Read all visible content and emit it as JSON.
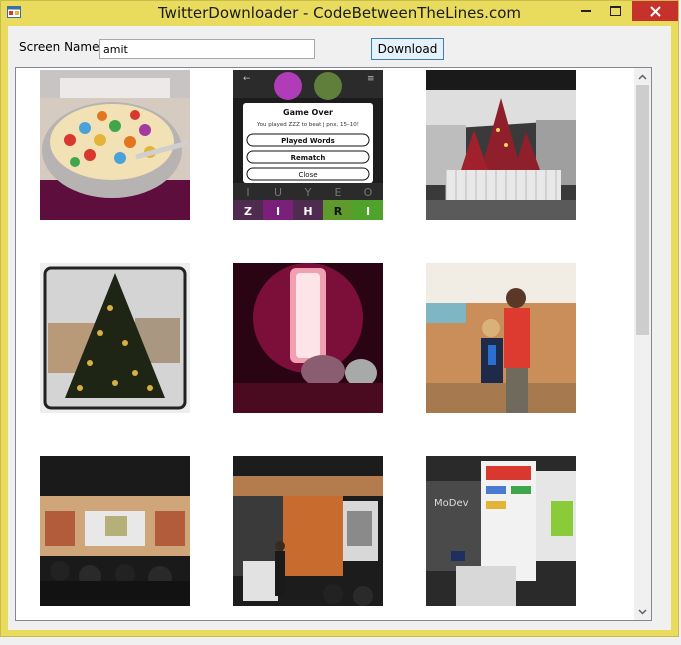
{
  "window": {
    "title": "TwitterDownloader - CodeBetweenTheLines.com",
    "controls": [
      "minimize-icon",
      "maximize-icon",
      "close-icon"
    ]
  },
  "form": {
    "screen_name_label": "Screen Name",
    "screen_name_value": "amit",
    "download_label": "Download"
  },
  "game_over": {
    "title": "Game Over",
    "message": "You played ZZZ to beat j pnx, 15–10!",
    "score_left": "10",
    "score_right": "15",
    "buttons": [
      "Played Words",
      "Rematch",
      "Close"
    ],
    "tiles_top": [
      "I",
      "U",
      "Y",
      "E",
      "O"
    ],
    "tiles_bottom": [
      "Z",
      "I",
      "H",
      "R",
      "I"
    ]
  },
  "colors": {
    "title_bar": "#e8db5e",
    "close_button": "#c7312c",
    "download_border": "#3c7fb1"
  }
}
